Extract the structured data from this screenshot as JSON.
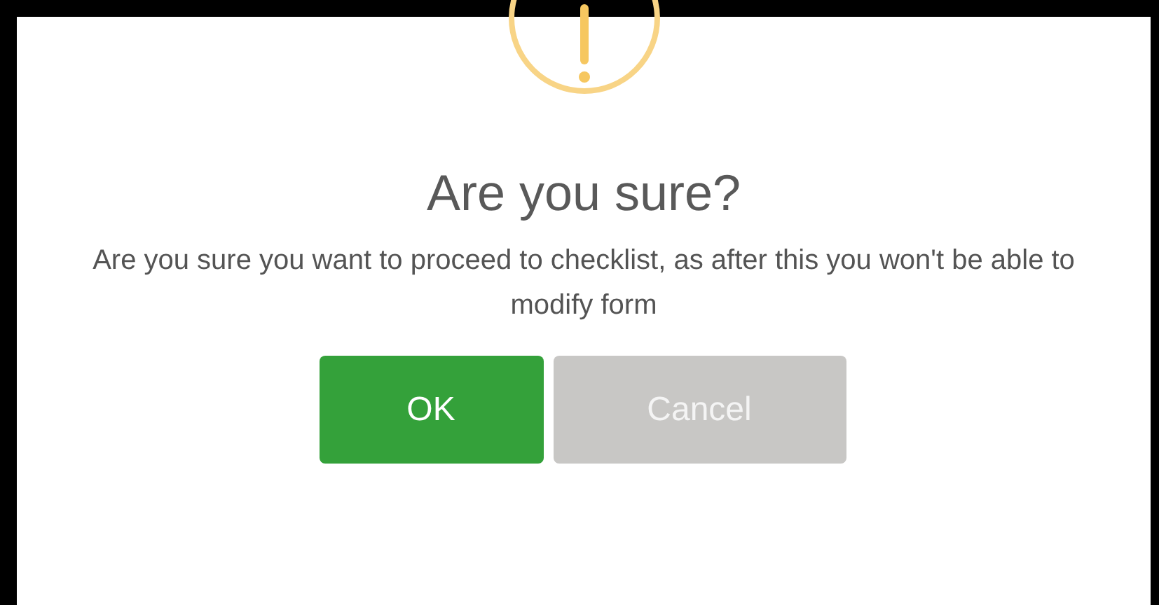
{
  "dialog": {
    "title": "Are you sure?",
    "message": "Are you sure you want to proceed to checklist, as after this you won't be able to modify form",
    "buttons": [
      {
        "label": "OK",
        "kind": "confirm"
      },
      {
        "label": "Cancel",
        "kind": "cancel"
      }
    ]
  }
}
